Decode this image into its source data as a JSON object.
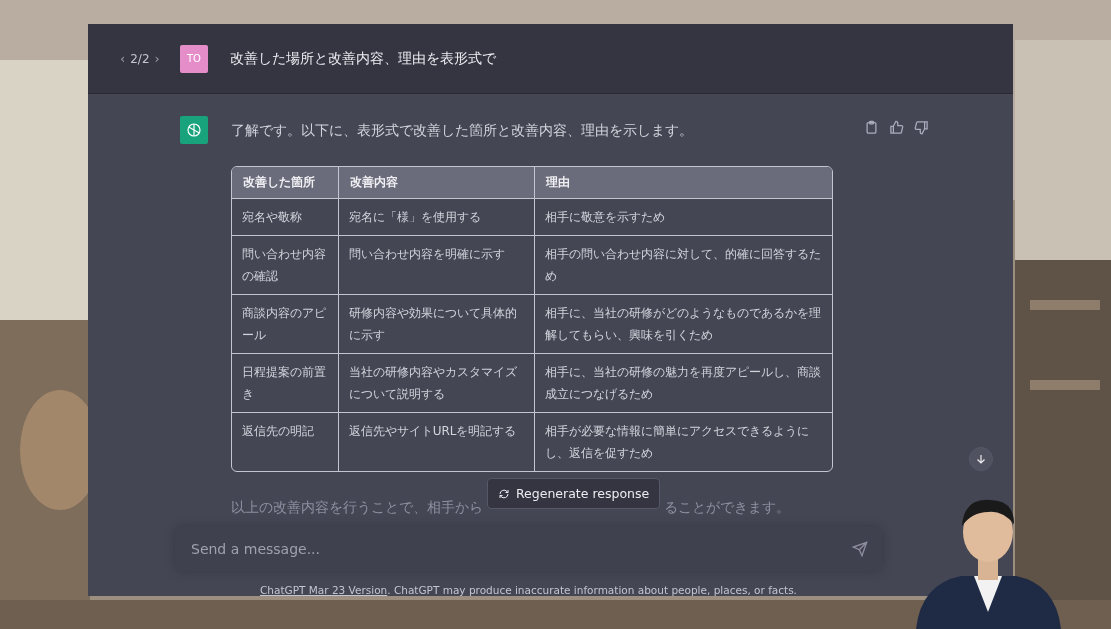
{
  "conversation": {
    "pager": {
      "prev": "‹",
      "position": "2/2",
      "next": "›"
    },
    "user_message": {
      "avatar": "TO",
      "text": "改善した場所と改善内容、理由を表形式で"
    },
    "assistant_message": {
      "intro": "了解です。以下に、表形式で改善した箇所と改善内容、理由を示します。",
      "table": {
        "columns": [
          "改善した箇所",
          "改善内容",
          "理由"
        ],
        "rows": [
          [
            "宛名や敬称",
            "宛名に「様」を使用する",
            "相手に敬意を示すため"
          ],
          [
            "問い合わせ内容の確認",
            "問い合わせ内容を明確に示す",
            "相手の問い合わせ内容に対して、的確に回答するため"
          ],
          [
            "商談内容のアピール",
            "研修内容や効果について具体的に示す",
            "相手に、当社の研修がどのようなものであるかを理解してもらい、興味を引くため"
          ],
          [
            "日程提案の前置き",
            "当社の研修内容やカスタマイズについて説明する",
            "相手に、当社の研修の魅力を再度アピールし、商談成立につなげるため"
          ],
          [
            "返信先の明記",
            "返信先やサイトURLを明記する",
            "相手が必要な情報に簡単にアクセスできるようにし、返信を促すため"
          ]
        ]
      },
      "closing_parts": [
        "以上の改善内容を行うことで、相手から",
        "ることができます。"
      ]
    }
  },
  "regenerate_button": "Regenerate response",
  "composer": {
    "placeholder": "Send a message..."
  },
  "footer": {
    "link": "ChatGPT Mar 23 Version",
    "text": ". ChatGPT may produce inaccurate information about people, places, or facts."
  }
}
